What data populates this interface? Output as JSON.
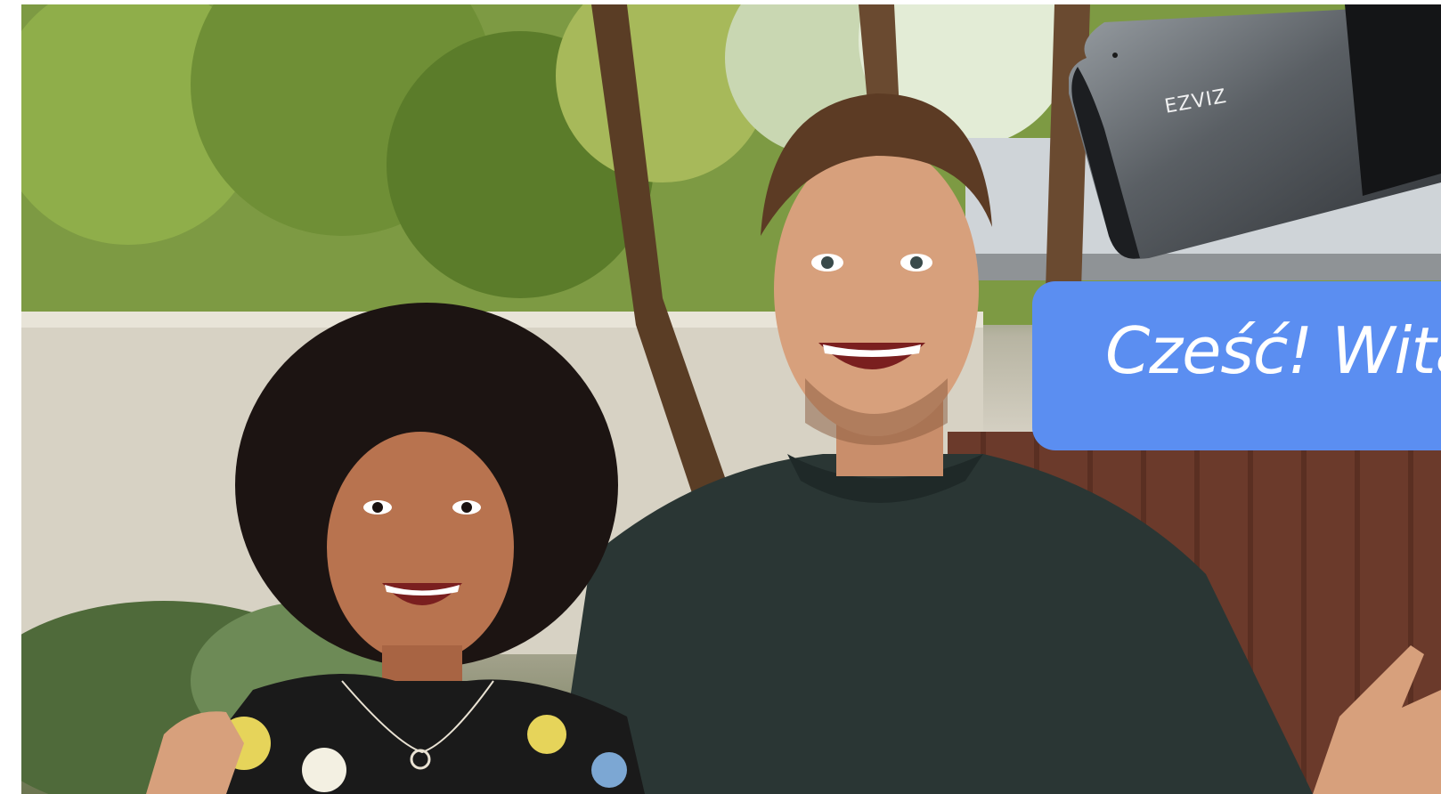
{
  "hero": {
    "image_description_icon": "hero-photo",
    "camera_brand": "EZVIZ",
    "greeting": "Cześć! Wita"
  },
  "colors": {
    "banner": "#5b8ef1",
    "foliage": "#6f8a3c",
    "wall": "#d6d1c4",
    "fence": "#6a3a2a",
    "shirt": "#263230",
    "camera_body": "#5a5e62"
  }
}
